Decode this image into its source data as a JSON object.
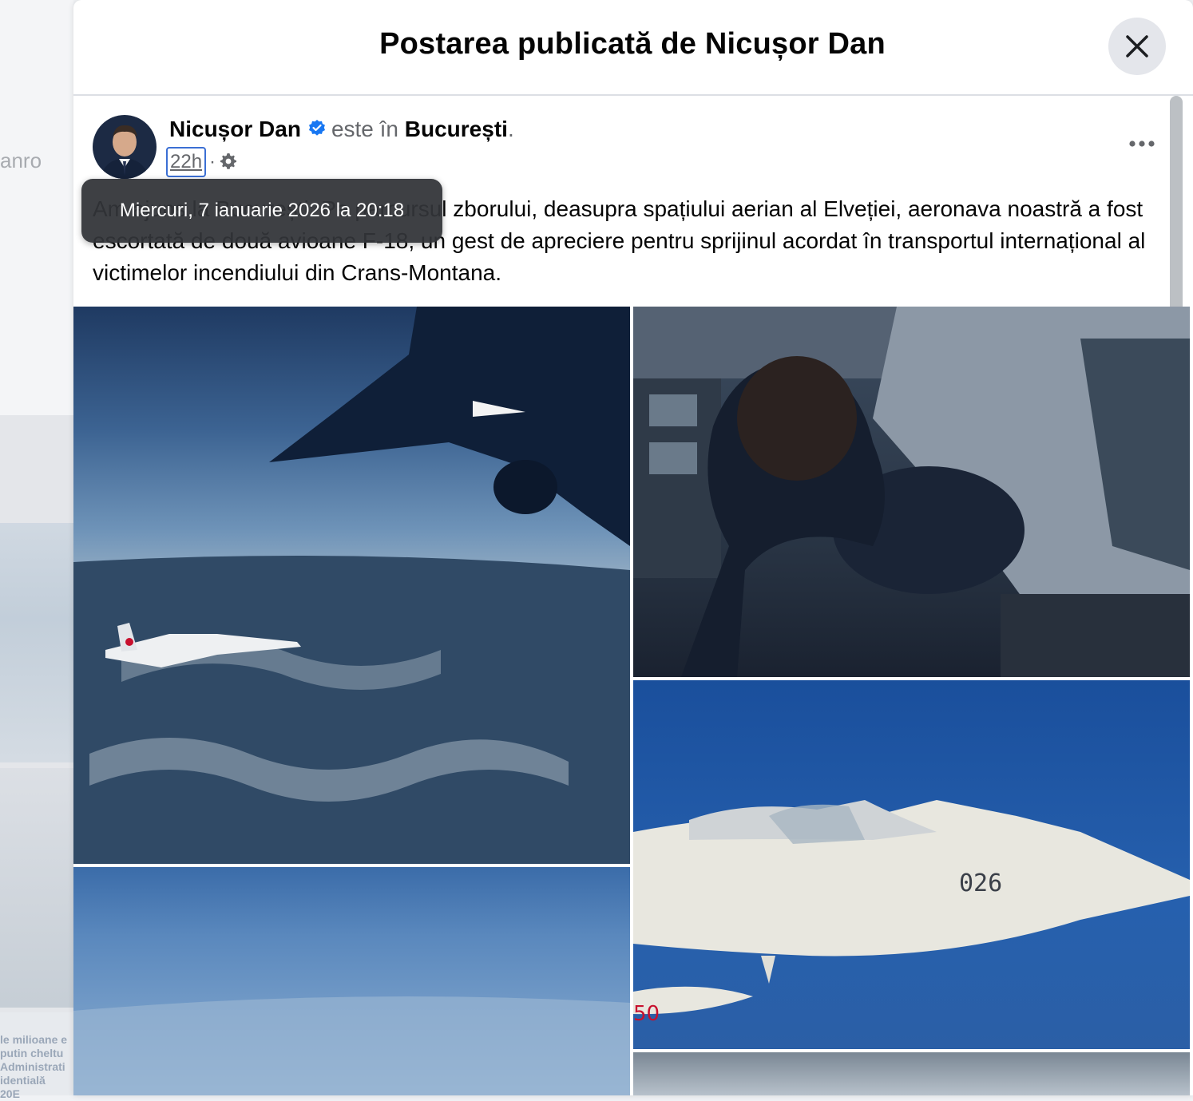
{
  "background": {
    "side_text": "anro",
    "caption_fragment": "le milioane e\nputin cheltu\nAdministrati\nidentială\n20E"
  },
  "modal": {
    "title": "Postarea publicată de Nicușor Dan",
    "close_icon": "close-icon"
  },
  "post": {
    "author": "Nicușor Dan",
    "verified_icon": "verified-badge-icon",
    "location_prefix": "este în",
    "location": "București",
    "location_suffix": ".",
    "timestamp": "22h",
    "separator": "·",
    "audience_icon": "gear-icon",
    "more_icon": "more-options-icon",
    "text": "Am ajuns la București. Pe parcursul zborului, deasupra spațiului aerian al Elveției, aeronava noastră a fost escortată de două avioane F-18, un gest de apreciere pentru sprijinul acordat în transportul internațional al victimelor incendiului din Crans-Montana."
  },
  "tooltip": {
    "text": "Miercuri, 7 ianuarie 2026 la 20:18"
  },
  "photos": [
    {
      "label": "F-18 escort over Switzerland seen from wing",
      "jet_number": ""
    },
    {
      "label": "Cockpit view",
      "jet_number": ""
    },
    {
      "label": "F-18 close-up",
      "jet_number": "026",
      "tank_number": "50"
    },
    {
      "label": "Sky over clouds",
      "jet_number": ""
    },
    {
      "label": "Additional photo",
      "jet_number": ""
    }
  ]
}
